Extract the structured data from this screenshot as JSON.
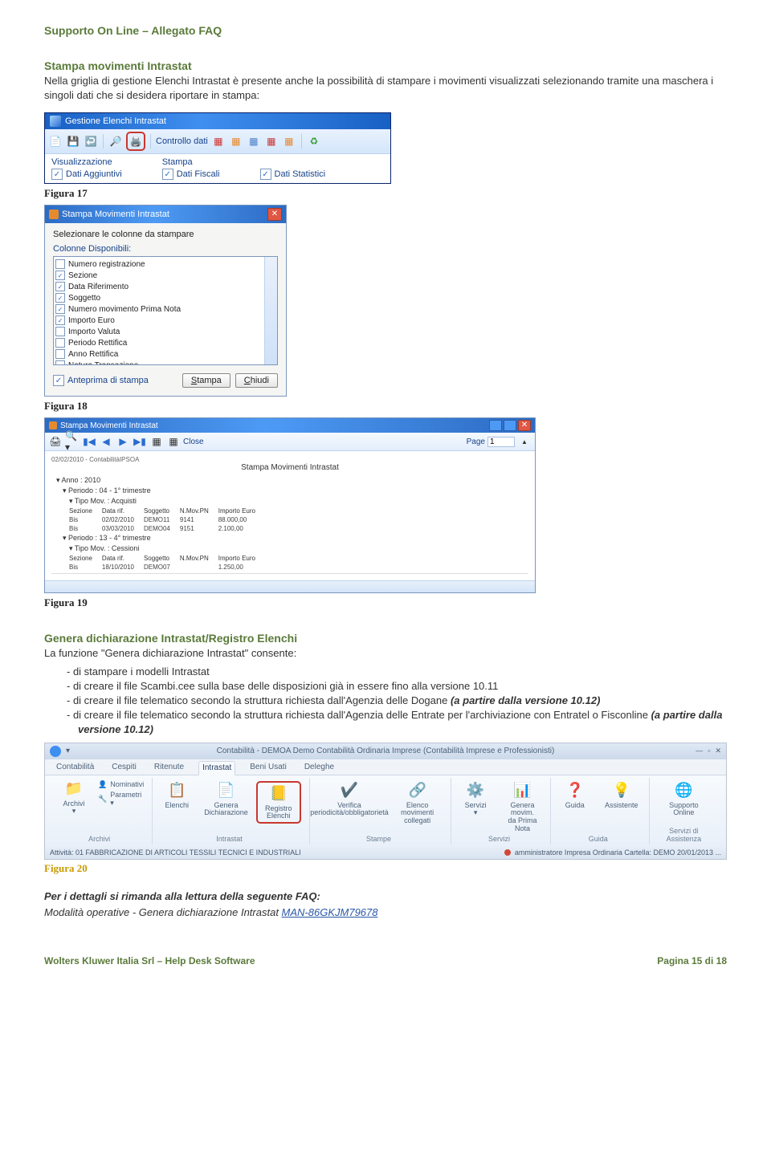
{
  "header": {
    "title": "Supporto On Line – Allegato FAQ"
  },
  "section1": {
    "heading": "Stampa movimenti Intrastat",
    "body": "Nella griglia di gestione Elenchi Intrastat è presente anche la possibilità di stampare i movimenti visualizzati selezionando tramite una maschera i singoli dati che si desidera riportare in stampa:"
  },
  "win1": {
    "title": "Gestione Elenchi Intrastat",
    "control_label": "Controllo dati",
    "vis_label": "Visualizzazione",
    "stampa_label": "Stampa",
    "chk1": "Dati Aggiuntivi",
    "chk2": "Dati Fiscali",
    "chk3": "Dati Statistici"
  },
  "fig17": "Figura 17",
  "dlg2": {
    "title": "Stampa Movimenti Intrastat",
    "instr": "Selezionare le colonne da stampare",
    "section": "Colonne Disponibili:",
    "items": [
      {
        "checked": false,
        "label": "Numero registrazione"
      },
      {
        "checked": true,
        "label": "Sezione"
      },
      {
        "checked": true,
        "label": "Data Riferimento"
      },
      {
        "checked": true,
        "label": "Soggetto"
      },
      {
        "checked": true,
        "label": "Numero movimento Prima Nota"
      },
      {
        "checked": true,
        "label": "Importo Euro"
      },
      {
        "checked": false,
        "label": "Importo Valuta"
      },
      {
        "checked": false,
        "label": "Periodo Rettifica"
      },
      {
        "checked": false,
        "label": "Anno Rettifica"
      },
      {
        "checked": false,
        "label": "Natura Transazione"
      }
    ],
    "anteprima": "Anteprima di stampa",
    "btn_stampa": "Stampa",
    "btn_chiudi": "Chiudi"
  },
  "fig18": "Figura 18",
  "preview": {
    "title": "Stampa Movimenti Intrastat",
    "close_label": "Close",
    "page_label": "Page",
    "page_value": "1",
    "sub_header": "02/02/2010 - ContabilitàIPSOA",
    "doc_title": "Stampa Movimenti Intrastat",
    "tree_anno": "Anno : 2010",
    "tree_per1": "Periodo : 04 - 1° trimestre",
    "tree_tipo1": "Tipo Mov. : Acquisti",
    "headers": [
      "Sezione",
      "Data rif.",
      "Soggetto",
      "N.Mov.PN",
      "Importo Euro"
    ],
    "rows1": [
      [
        "Bis",
        "02/02/2010",
        "DEMO11",
        "9141",
        "88.000,00"
      ],
      [
        "Bis",
        "03/03/2010",
        "DEMO04",
        "9151",
        "2.100,00"
      ]
    ],
    "tree_per2": "Periodo : 13 - 4° trimestre",
    "tree_tipo2": "Tipo Mov. : Cessioni",
    "rows2": [
      [
        "Bis",
        "18/10/2010",
        "DEMO07",
        "",
        "1.250,00"
      ]
    ]
  },
  "fig19": "Figura 19",
  "section2": {
    "heading": "Genera dichiarazione Intrastat/Registro Elenchi",
    "intro": "La funzione \"Genera dichiarazione Intrastat\" consente:",
    "bullets": [
      "di stampare i modelli Intrastat",
      "di creare il file Scambi.cee sulla base delle disposizioni già in essere fino alla versione 10.11",
      "di creare il file telematico secondo la struttura richiesta dall'Agenzia delle Dogane <span class=\"italic bold\">(a partire dalla versione 10.12)</span>",
      "di creare il file telematico secondo la struttura richiesta dall'Agenzia delle Entrate per l'archiviazione con Entratel o Fisconline <span class=\"italic bold\">(a partire dalla versione 10.12)</span>"
    ]
  },
  "ribbon": {
    "title_center": "Contabilità - DEMOA Demo Contabilità Ordinaria Imprese (Contabilità Imprese e Professionisti)",
    "tabs": [
      "Contabilità",
      "Cespiti",
      "Ritenute",
      "Intrastat",
      "Beni Usati",
      "Deleghe"
    ],
    "active_tab_index": 3,
    "group_archivi": {
      "btn_label": "Archivi\n▾",
      "stack": [
        "Nominativi",
        "Parametri ▾"
      ],
      "group_label": "Archivi"
    },
    "group_intrastat": {
      "btn1": "Elenchi",
      "btn2": "Genera\nDichiarazione",
      "btn3": "Registro\nElenchi",
      "group_label": "Intrastat"
    },
    "group_stampe": {
      "btn1": "Verifica\nperiodicità/obbligatorietà",
      "btn2": "Elenco movimenti\ncollegati",
      "group_label": "Stampe"
    },
    "group_servizi": {
      "btn1": "Servizi\n▾",
      "btn2": "Genera movim.\nda Prima Nota",
      "group_label": "Servizi"
    },
    "group_guida": {
      "btn1": "Guida",
      "btn2": "Assistente",
      "group_label": "Guida"
    },
    "group_supporto": {
      "btn1": "Supporto\nOnline",
      "group_label": "Servizi di Assistenza"
    },
    "status_left": "Attività: 01 FABBRICAZIONE DI ARTICOLI TESSILI TECNICI E INDUSTRIALI",
    "status_right": "amministratore Impresa Ordinaria Cartella: DEMO 20/01/2013 ..."
  },
  "fig20": "Figura 20",
  "closing": {
    "line1": "Per i dettagli si rimanda alla lettura della seguente FAQ:",
    "line2_prefix": "Modalità operative - Genera dichiarazione Intrastat ",
    "link": "MAN-86GKJM79678"
  },
  "footer": {
    "left": "Wolters Kluwer Italia Srl – Help Desk Software",
    "right": "Pagina 15 di 18"
  }
}
